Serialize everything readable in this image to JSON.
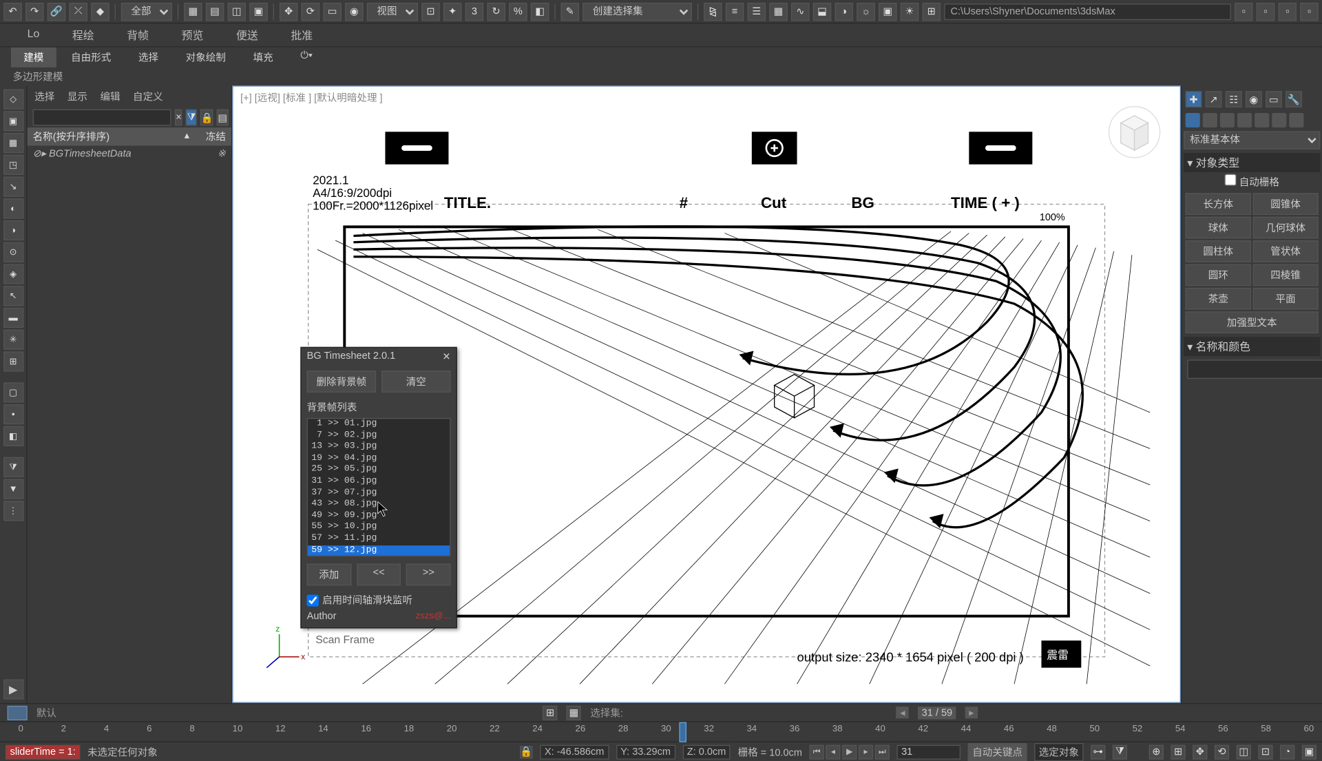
{
  "toolbar": {
    "all_dd": "全部",
    "view_dd": "视图",
    "selset_dd": "创建选择集",
    "path": "C:\\Users\\Shyner\\Documents\\3dsMax"
  },
  "menu": {
    "items": [
      "Lo",
      "程绘",
      "背帧",
      "预览",
      "便送",
      "批准"
    ]
  },
  "tabs": {
    "items": [
      "建模",
      "自由形式",
      "选择",
      "对象绘制",
      "填充"
    ],
    "active": 0,
    "sub": "多边形建模"
  },
  "outliner": {
    "tabs": [
      "选择",
      "显示",
      "编辑",
      "自定义"
    ],
    "hdr_name": "名称(按升序排序)",
    "hdr_frozen": "冻结",
    "row_name": "⊘▸ BGTimesheetData",
    "row_frozen": "※"
  },
  "viewport": {
    "label": "[+] [远视] [标准 ] [默认明暗处理 ]",
    "pct": "100%",
    "meta_date": "2021.1",
    "meta_fmt": "A4/16:9/200dpi",
    "meta_fr": "100Fr.=2000*1126pixel",
    "meta_title": "TITLE.",
    "meta_hash": "#",
    "meta_cut": "Cut",
    "meta_bg": "BG",
    "meta_time": "TIME (        +        )",
    "meta_out": "output size:   2340 * 1654 pixel   ( 200 dpi )",
    "meta_scan": "Scan Frame"
  },
  "cmd": {
    "dd": "标准基本体",
    "sect_type": "对象类型",
    "autogrid": "自动栅格",
    "objs": [
      "长方体",
      "圆锥体",
      "球体",
      "几何球体",
      "圆柱体",
      "管状体",
      "圆环",
      "四棱锥",
      "茶壶",
      "平面",
      "加强型文本"
    ],
    "sect_name": "名称和颜色"
  },
  "dialog": {
    "title": "BG Timesheet 2.0.1",
    "btn_del": "删除背景帧",
    "btn_clear": "清空",
    "list_label": "背景帧列表",
    "items": [
      " 1 >> 01.jpg",
      " 7 >> 02.jpg",
      "13 >> 03.jpg",
      "19 >> 04.jpg",
      "25 >> 05.jpg",
      "31 >> 06.jpg",
      "37 >> 07.jpg",
      "43 >> 08.jpg",
      "49 >> 09.jpg",
      "55 >> 10.jpg",
      "57 >> 11.jpg",
      "59 >> 12.jpg"
    ],
    "sel": 11,
    "btn_add": "添加",
    "btn_prev": "<<",
    "btn_next": ">>",
    "chk": "启用时间轴滑块监听",
    "auth_l": "Author",
    "auth_r": "zszs@..."
  },
  "bottom": {
    "default": "默认",
    "selset": "选择集:",
    "frame": "31 / 59"
  },
  "timeline": {
    "ticks": [
      0,
      2,
      4,
      6,
      8,
      10,
      12,
      14,
      16,
      18,
      20,
      22,
      24,
      26,
      28,
      30,
      32,
      34,
      36,
      38,
      40,
      42,
      44,
      46,
      48,
      50,
      52,
      54,
      56,
      58,
      60
    ],
    "current": 31
  },
  "status": {
    "slider": "sliderTime = 1:",
    "nosel": "未选定任何对象",
    "x": "X: -46.586cm",
    "y": "Y: 33.29cm",
    "z": "Z: 0.0cm",
    "grid": "栅格 = 10.0cm",
    "autokey": "自动关键点",
    "selobj": "选定对象"
  }
}
